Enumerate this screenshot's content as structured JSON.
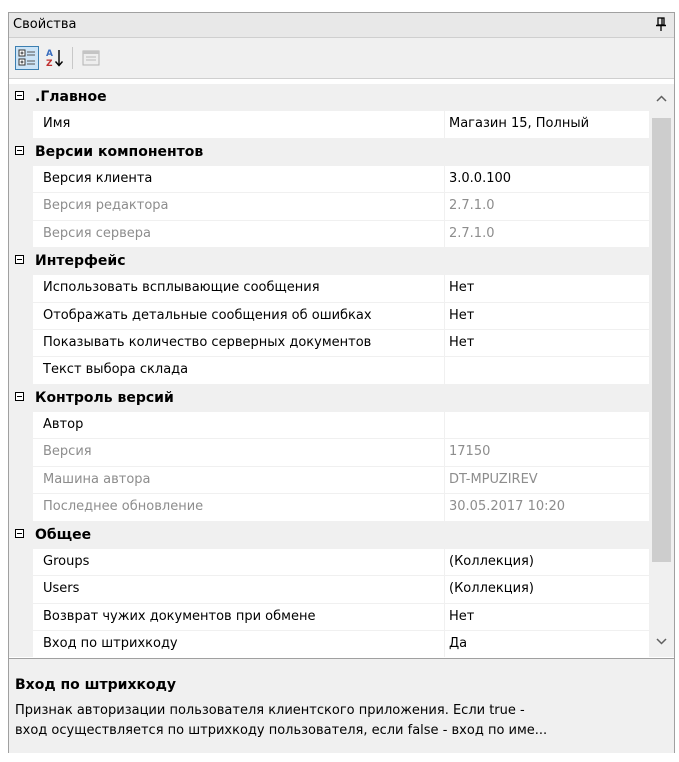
{
  "panel": {
    "title": "Свойства"
  },
  "toolbar": {
    "buttons": [
      {
        "name": "categorized",
        "icon": "categorized-view-icon",
        "active": true
      },
      {
        "name": "alphabetical",
        "icon": "sort-az-icon",
        "active": false
      },
      {
        "name": "property-pages",
        "icon": "property-pages-icon",
        "enabled": false
      }
    ]
  },
  "grid": {
    "categories": [
      {
        "label": ".Главное",
        "properties": [
          {
            "name": "Имя",
            "value": "Магазин 15, Полный",
            "readonly": false
          }
        ]
      },
      {
        "label": "Версии компонентов",
        "properties": [
          {
            "name": "Версия клиента",
            "value": "3.0.0.100",
            "readonly": false
          },
          {
            "name": "Версия редактора",
            "value": "2.7.1.0",
            "readonly": true
          },
          {
            "name": "Версия сервера",
            "value": "2.7.1.0",
            "readonly": true
          }
        ]
      },
      {
        "label": "Интерфейс",
        "properties": [
          {
            "name": "Использовать всплывающие сообщения",
            "value": "Нет",
            "readonly": false
          },
          {
            "name": "Отображать детальные сообщения об ошибках",
            "value": "Нет",
            "readonly": false
          },
          {
            "name": "Показывать количество серверных документов",
            "value": "Нет",
            "readonly": false
          },
          {
            "name": "Текст выбора склада",
            "value": "",
            "readonly": false
          }
        ]
      },
      {
        "label": "Контроль версий",
        "properties": [
          {
            "name": "Автор",
            "value": "",
            "readonly": false
          },
          {
            "name": "Версия",
            "value": "17150",
            "readonly": true
          },
          {
            "name": "Машина автора",
            "value": "DT-MPUZIREV",
            "readonly": true
          },
          {
            "name": "Последнее обновление",
            "value": "30.05.2017 10:20",
            "readonly": true
          }
        ]
      },
      {
        "label": "Общее",
        "properties": [
          {
            "name": "Groups",
            "value": "(Коллекция)",
            "readonly": false
          },
          {
            "name": "Users",
            "value": "(Коллекция)",
            "readonly": false
          },
          {
            "name": "Возврат чужих документов при обмене",
            "value": "Нет",
            "readonly": false
          },
          {
            "name": "Вход по штрихкоду",
            "value": "Да",
            "readonly": false
          }
        ]
      }
    ]
  },
  "description": {
    "title": "Вход по штрихкоду",
    "lines": [
      "Признак авторизации пользователя клиентского приложения. Если true -",
      "вход осуществляется по штрихкоду пользователя, если false - вход по име..."
    ]
  },
  "colors": {
    "category_background": "#f0f0f0",
    "readonly_text": "#8d8d8d",
    "active_button": "#cce4f7"
  }
}
